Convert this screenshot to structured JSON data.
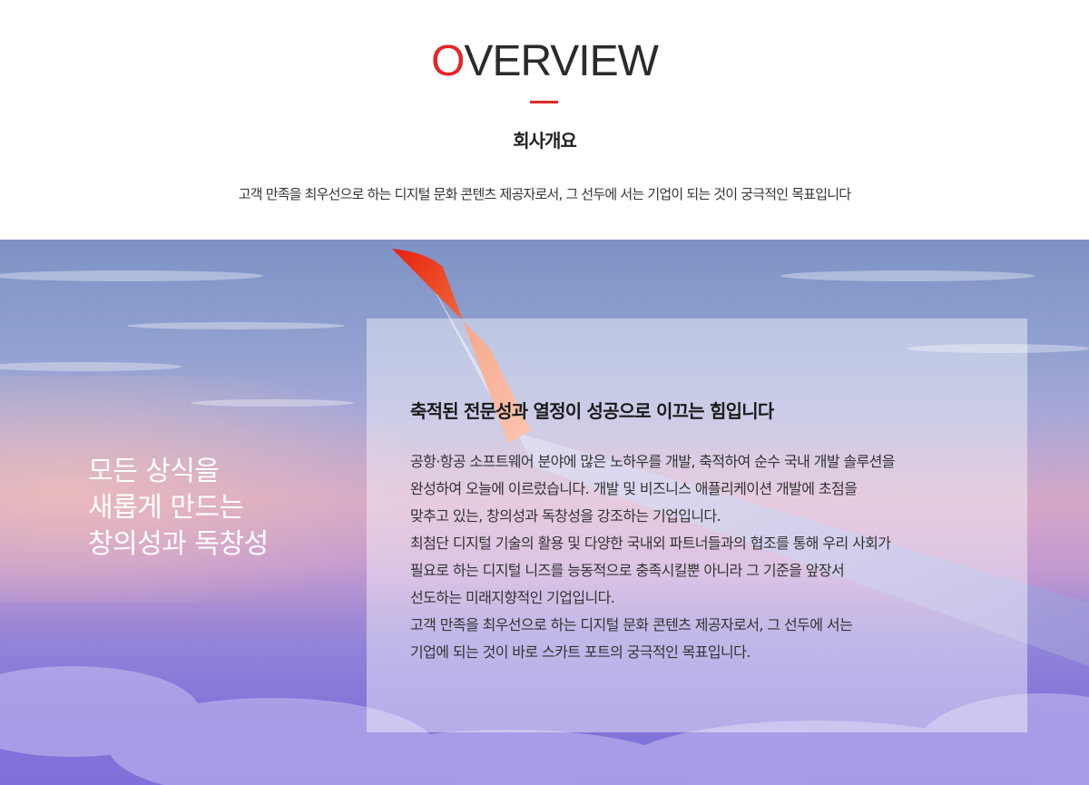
{
  "overview": {
    "title_first_letter": "O",
    "title_rest": "VERVIEW",
    "subtitle": "회사개요",
    "tagline": "고객 만족을 최우선으로 하는 디지털 문화 콘텐츠 제공자로서, 그 선두에 서는 기업이 되는 것이  궁극적인 목표입니다"
  },
  "hero": {
    "heading_lines": [
      "모든 상식을",
      "새롭게 만드는",
      "창의성과 독창성"
    ],
    "card_title": "축적된 전문성과 열정이 성공으로 이끄는 힘입니다",
    "card_lines": [
      "공항·항공 소프트웨어 분야에 많은 노하우를 개발, 축적하여 순수 국내 개발 솔루션을",
      "완성하여 오늘에 이르렀습니다. 개발 및 비즈니스 애플리케이션 개발에 초점을",
      "맞추고 있는, 창의성과 독창성을 강조하는 기업입니다.",
      "최첨단 디지털 기술의 활용 및 다양한 국내외 파트너들과의 협조를 통해 우리 사회가",
      "필요로 하는 디지털 니즈를 능동적으로 충족시킬뿐 아니라 그 기준을 앞장서",
      "선도하는 미래지향적인 기업입니다.",
      "고객 만족을 최우선으로 하는 디지털 문화 콘텐츠 제공자로서, 그 선두에 서는",
      "기업에 되는 것이 바로 스카트 포트의 궁극적인 목표입니다."
    ]
  },
  "colors": {
    "accent": "#e3262a",
    "text_dark": "#2b2b2b",
    "sky_top": "#7e92c6",
    "sky_bottom": "#5a50c8"
  }
}
